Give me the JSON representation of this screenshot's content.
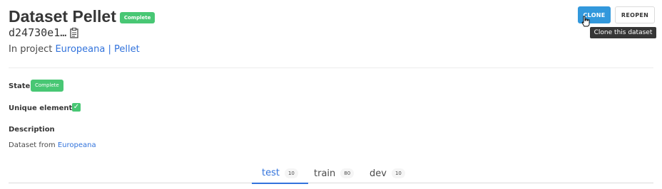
{
  "header": {
    "title": "Dataset Pellet",
    "status_badge": "Complete",
    "hash": "d24730e1…",
    "clipboard_icon": "clipboard-icon",
    "project_prefix": "In project",
    "project_link": "Europeana | Pellet"
  },
  "actions": {
    "clone_label": "CLONE",
    "reopen_label": "REOPEN",
    "clone_tooltip": "Clone this dataset"
  },
  "details": {
    "state_label": "State",
    "state_value": "Complete",
    "unique_label": "Unique elements",
    "unique_icon": "checkmark-icon",
    "description_label": "Description",
    "description_prefix": "Dataset from",
    "description_link": "Europeana"
  },
  "tabs": [
    {
      "label": "test",
      "count": "10",
      "active": true
    },
    {
      "label": "train",
      "count": "80",
      "active": false
    },
    {
      "label": "dev",
      "count": "10",
      "active": false
    }
  ],
  "colors": {
    "success": "#48c774",
    "link": "#3273dc",
    "primary_button": "#3298dc",
    "tooltip_bg": "#363636"
  }
}
